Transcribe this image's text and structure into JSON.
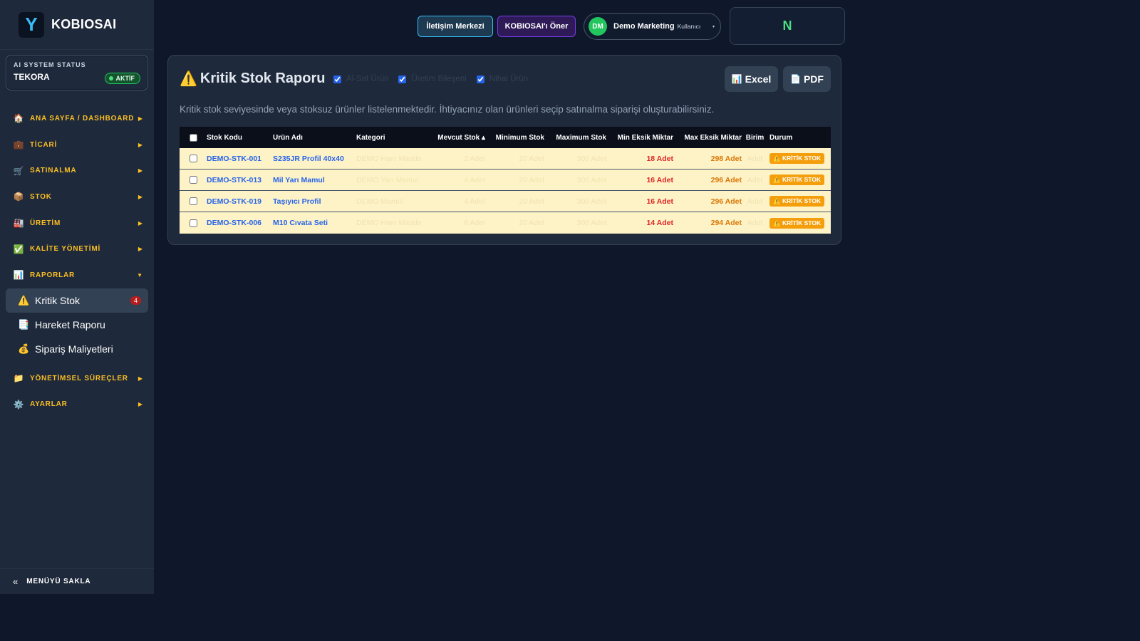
{
  "brand": {
    "logo_letter": "Y",
    "name": "KOBIOSAI"
  },
  "ai_status": {
    "label": "AI SYSTEM STATUS",
    "name": "TEKORA",
    "badge": "AKTİF"
  },
  "sidebar": {
    "items": [
      {
        "icon": "🏠",
        "label": "ANA SAYFA / DASHBOARD",
        "arrow": "▶"
      },
      {
        "icon": "💼",
        "label": "TİCARİ",
        "arrow": "▶"
      },
      {
        "icon": "🛒",
        "label": "SATINALMA",
        "arrow": "▶"
      },
      {
        "icon": "📦",
        "label": "STOK",
        "arrow": "▶"
      },
      {
        "icon": "🏭",
        "label": "ÜRETİM",
        "arrow": "▶"
      },
      {
        "icon": "✅",
        "label": "KALİTE YÖNETİMİ",
        "arrow": "▶"
      },
      {
        "icon": "📊",
        "label": "RAPORLAR",
        "arrow": "▼"
      }
    ],
    "sub_items": [
      {
        "icon": "⚠️",
        "label": "Kritik Stok",
        "badge": "4"
      },
      {
        "icon": "📑",
        "label": "Hareket Raporu"
      },
      {
        "icon": "💰",
        "label": "Sipariş Maliyetleri"
      }
    ],
    "items_after": [
      {
        "icon": "📁",
        "label": "YÖNETİMSEL SÜREÇLER",
        "arrow": "▶"
      },
      {
        "icon": "⚙️",
        "label": "AYARLAR",
        "arrow": "▶"
      }
    ],
    "hide_icon": "«",
    "hide_label": "MENÜYÜ SAKLA"
  },
  "header": {
    "contact_label": "İletişim Merkezi",
    "suggest_label": "KOBIOSAI'ı Öner",
    "user_initials": "DM",
    "user_name": "Demo Marketing",
    "user_role": "Kullanıcı",
    "user_caret": "▾",
    "n_label": "N"
  },
  "report": {
    "title_icon": "⚠️",
    "title": "Kritik Stok Raporu",
    "filters": [
      {
        "label": "Al-Sat Ürün",
        "checked": true
      },
      {
        "label": "Üretim Bileşeni",
        "checked": true
      },
      {
        "label": "Nihai Ürün",
        "checked": true
      }
    ],
    "excel_icon": "📊",
    "excel_label": "Excel",
    "pdf_icon": "📄",
    "pdf_label": "PDF",
    "description": "Kritik stok seviyesinde veya stoksuz ürünler listelenmektedir. İhtiyacınız olan ürünleri seçip satınalma siparişi oluşturabilirsiniz.",
    "columns": [
      "Stok Kodu",
      "Ürün Adı",
      "Kategori",
      "Mevcut Stok ▴",
      "Minimum Stok",
      "Maximum Stok",
      "Min Eksik Miktar",
      "Max Eksik Miktar",
      "Birim",
      "Durum"
    ],
    "rows": [
      {
        "code": "DEMO-STK-001",
        "name": "S235JR Profil 40x40",
        "category": "DEMO Ham Madde",
        "current": "2 Adet",
        "min": "20 Adet",
        "max": "300 Adet",
        "min_missing": "18 Adet",
        "max_missing": "298 Adet",
        "unit": "Adet",
        "status": "⚠️ KRİTİK STOK"
      },
      {
        "code": "DEMO-STK-013",
        "name": "Mil Yarı Mamul",
        "category": "DEMO Yarı Mamul",
        "current": "4 Adet",
        "min": "20 Adet",
        "max": "300 Adet",
        "min_missing": "16 Adet",
        "max_missing": "296 Adet",
        "unit": "Adet",
        "status": "⚠️ KRİTİK STOK"
      },
      {
        "code": "DEMO-STK-019",
        "name": "Taşıyıcı Profil",
        "category": "DEMO Mamul",
        "current": "4 Adet",
        "min": "20 Adet",
        "max": "300 Adet",
        "min_missing": "16 Adet",
        "max_missing": "296 Adet",
        "unit": "Adet",
        "status": "⚠️ KRİTİK STOK"
      },
      {
        "code": "DEMO-STK-006",
        "name": "M10 Cıvata Seti",
        "category": "DEMO Ham Madde",
        "current": "6 Adet",
        "min": "20 Adet",
        "max": "300 Adet",
        "min_missing": "14 Adet",
        "max_missing": "294 Adet",
        "unit": "Adet",
        "status": "⚠️ KRİTİK STOK"
      }
    ]
  },
  "colors": {
    "accent": "#fbbf24",
    "link": "#2563eb",
    "critical": "#f59e0b",
    "row_bg": "#fef3c7"
  }
}
